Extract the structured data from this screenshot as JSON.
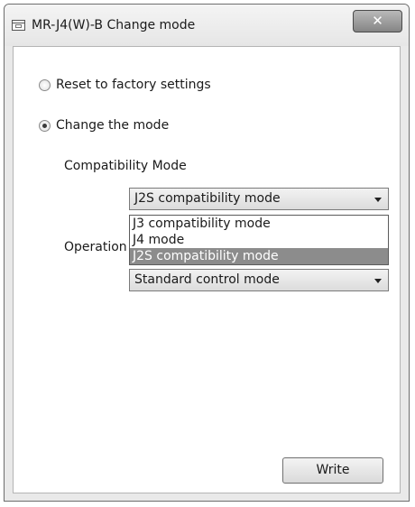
{
  "window": {
    "title": "MR-J4(W)-B Change mode",
    "close_label": "✕"
  },
  "options": {
    "reset_label": "Reset to factory settings",
    "change_label": "Change the mode",
    "selected": "change"
  },
  "compatibility": {
    "label": "Compatibility Mode",
    "selected_value": "J2S compatibility mode",
    "dropdown_options": [
      "J3 compatibility mode",
      "J4 mode",
      "J2S compatibility mode"
    ],
    "highlighted_index": 2
  },
  "operation": {
    "label": "Operation",
    "selected_value": "Standard control mode"
  },
  "buttons": {
    "write_label": "Write"
  }
}
